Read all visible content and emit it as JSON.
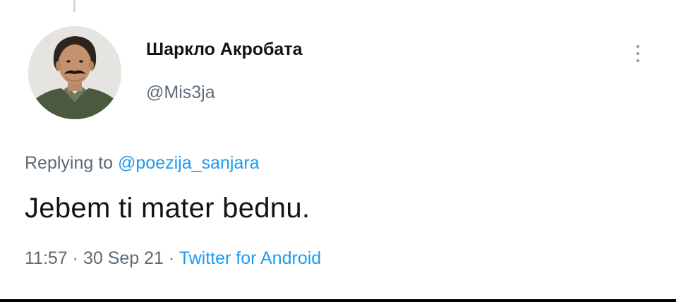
{
  "tweet": {
    "display_name": "Шаркло Акробата",
    "handle": "@Mis3ja",
    "reply_prefix": "Replying to ",
    "reply_to": "@poezija_sanjara",
    "text": "Jebem ti mater bednu.",
    "time": "11:57",
    "separator": " · ",
    "date": "30 Sep 21",
    "source": "Twitter for Android"
  },
  "icons": {
    "more": "vertical-ellipsis-icon",
    "avatar": "profile-photo"
  },
  "colors": {
    "link": "#1d9bf0",
    "text": "#0f1419",
    "secondary": "#5d6a75"
  }
}
